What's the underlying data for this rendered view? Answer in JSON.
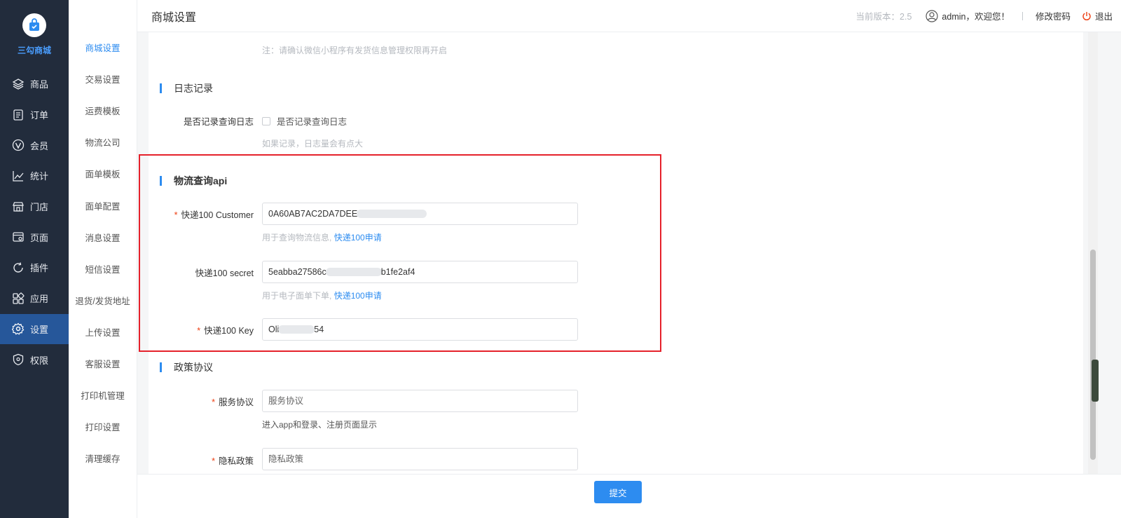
{
  "brand": {
    "name": "三勾商城"
  },
  "sidebar": {
    "items": [
      {
        "label": "商品",
        "icon": "layers-icon"
      },
      {
        "label": "订单",
        "icon": "document-icon"
      },
      {
        "label": "会员",
        "icon": "vip-icon"
      },
      {
        "label": "统计",
        "icon": "chart-line-icon"
      },
      {
        "label": "门店",
        "icon": "store-icon"
      },
      {
        "label": "页面",
        "icon": "page-icon"
      },
      {
        "label": "插件",
        "icon": "refresh-icon"
      },
      {
        "label": "应用",
        "icon": "apps-icon"
      },
      {
        "label": "设置",
        "icon": "gear-icon",
        "active": true
      },
      {
        "label": "权限",
        "icon": "shield-icon"
      }
    ]
  },
  "submenu": {
    "items": [
      "商城设置",
      "交易设置",
      "运费模板",
      "物流公司",
      "面单模板",
      "面单配置",
      "消息设置",
      "短信设置",
      "退货/发货地址",
      "上传设置",
      "客服设置",
      "打印机管理",
      "打印设置",
      "清理缓存"
    ],
    "active_index": 0
  },
  "header": {
    "title": "商城设置",
    "version": "当前版本：2.5",
    "user": "admin，欢迎您！",
    "change_password": "修改密码",
    "logout": "退出"
  },
  "content": {
    "top_note": "注：请确认微信小程序有发货信息管理权限再开启",
    "log_section": {
      "title": "日志记录",
      "label": "是否记录查询日志",
      "checkbox_label": "是否记录查询日志",
      "checked": false,
      "help": "如果记录，日志量会有点大"
    },
    "api_section": {
      "title": "物流查询api",
      "customer": {
        "label": "快递100 Customer",
        "value_start": "0A60AB7AC2DA7DEE",
        "value_end": "",
        "help": "用于查询物流信息,",
        "help_link": "快递100申请"
      },
      "secret": {
        "label": "快递100 secret",
        "value_start": "5eabba27586c",
        "value_end": "b1fe2af4",
        "help": "用于电子面单下单,",
        "help_link": "快递100申请"
      },
      "key": {
        "label": "快递100 Key",
        "value_start": "Oli",
        "value_end": "54"
      }
    },
    "policy_section": {
      "title": "政策协议",
      "service": {
        "label": "服务协议",
        "placeholder": "服务协议",
        "help": "进入app和登录、注册页面显示"
      },
      "privacy": {
        "label": "隐私政策",
        "placeholder": "隐私政策"
      }
    }
  },
  "footer": {
    "submit_label": "提交"
  },
  "colors": {
    "primary": "#2d8cf0",
    "sidebar_bg": "#222c3c",
    "required": "#ed4014",
    "highlight": "#e5212b"
  }
}
